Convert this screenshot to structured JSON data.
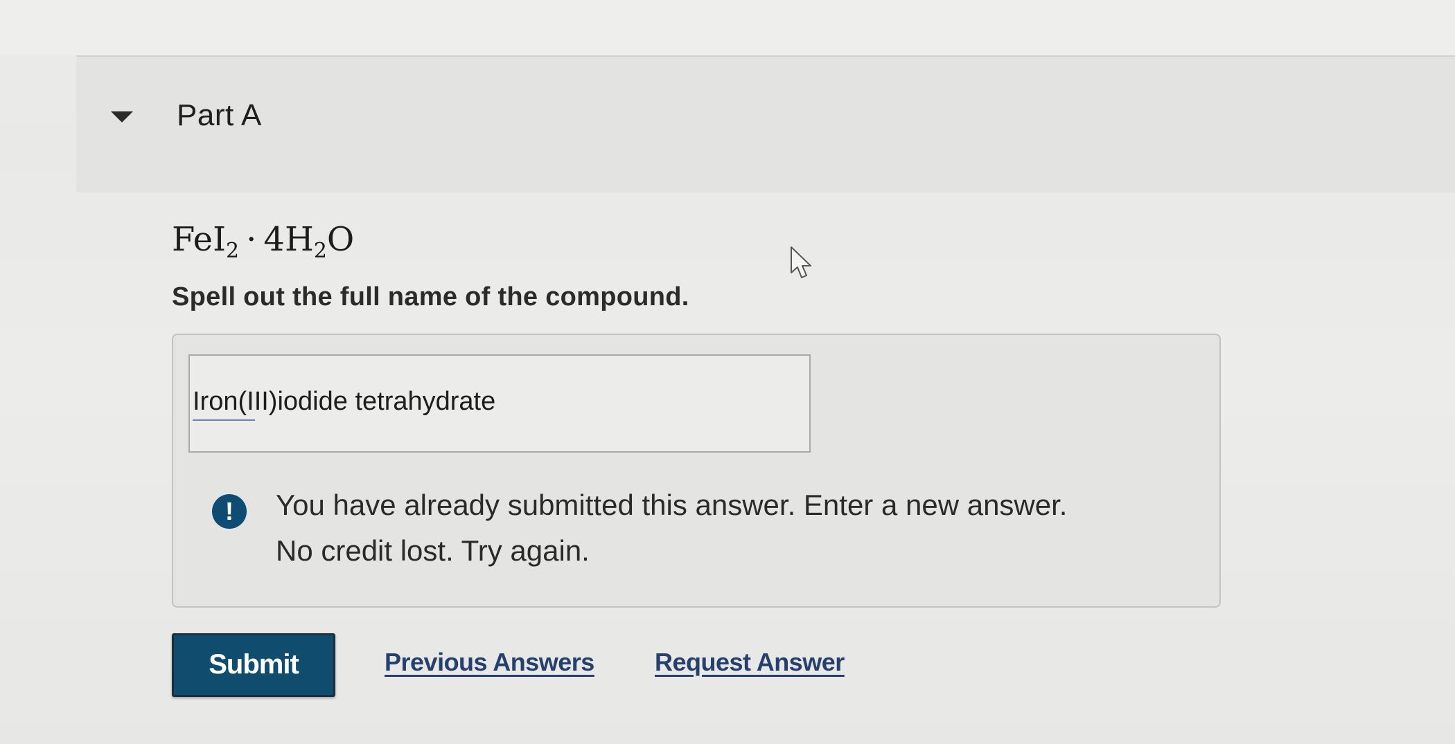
{
  "part": {
    "title": "Part A"
  },
  "question": {
    "formula": {
      "base_1": "FeI",
      "sub_1": "2",
      "separator": "·",
      "base_2": "4H",
      "sub_2": "2",
      "base_3": "O"
    },
    "prompt": "Spell out the full name of the compound."
  },
  "answer": {
    "value": "Iron(III)iodide tetrahydrate"
  },
  "feedback": {
    "icon_glyph": "!",
    "line_1": "You have already submitted this answer. Enter a new answer.",
    "line_2": "No credit lost. Try again."
  },
  "actions": {
    "submit_label": "Submit",
    "previous_answers_label": "Previous Answers",
    "request_answer_label": "Request Answer"
  },
  "colors": {
    "submit_bg": "#0f4c6d",
    "alert_icon": "#0f4c74",
    "link": "#26406e"
  },
  "icons": {
    "collapse": "caret-down-icon",
    "alert": "exclamation-circle-icon",
    "pointer": "mouse-cursor-icon"
  }
}
